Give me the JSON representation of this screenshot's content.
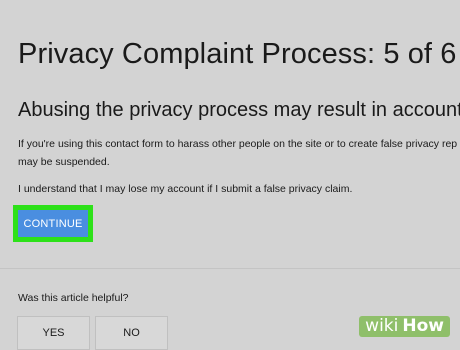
{
  "page": {
    "title": "Privacy Complaint Process: 5 of 6",
    "warning_heading": "Abusing the privacy process may result in account",
    "paragraph1_line1": "If you're using this contact form to harass other people on the site or to create false privacy rep",
    "paragraph1_line2": "may be suspended.",
    "paragraph2": "I understand that I may lose my account if I submit a false privacy claim.",
    "continue_label": "CONTINUE"
  },
  "feedback": {
    "question": "Was this article helpful?",
    "yes_label": "YES",
    "no_label": "NO"
  },
  "watermark": {
    "wiki": "wiki",
    "how": "How"
  },
  "colors": {
    "background": "#d3d3d3",
    "continue_button": "#4a8ee0",
    "highlight_box": "#2de119",
    "watermark": "#8fbf6a"
  }
}
